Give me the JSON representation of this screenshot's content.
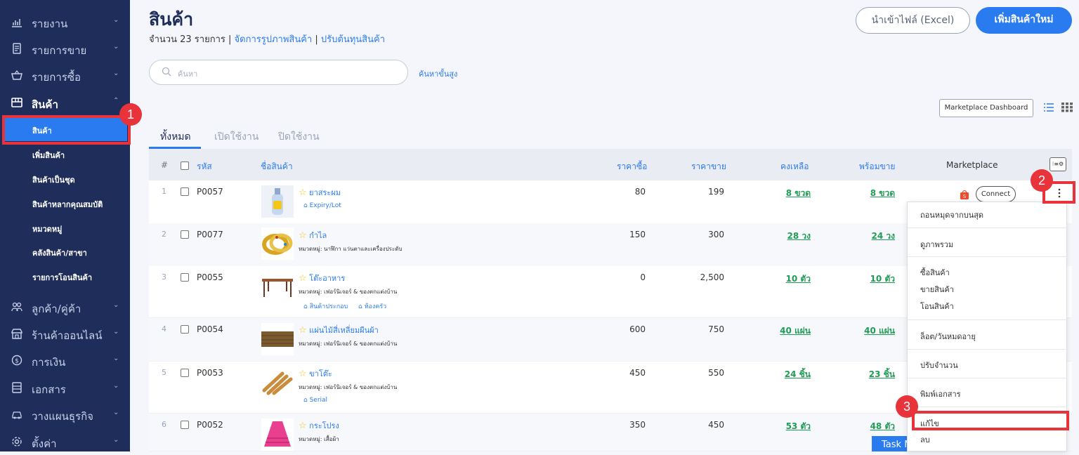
{
  "sidebar": {
    "items": [
      {
        "label": "รายงาน",
        "icon": "bar-chart-icon"
      },
      {
        "label": "รายการขาย",
        "icon": "receipt-icon"
      },
      {
        "label": "รายการซื้อ",
        "icon": "basket-icon"
      },
      {
        "label": "สินค้า",
        "icon": "box-icon"
      },
      {
        "label": "ลูกค้า/คู่ค้า",
        "icon": "users-icon"
      },
      {
        "label": "ร้านค้าออนไลน์",
        "icon": "store-icon"
      },
      {
        "label": "การเงิน",
        "icon": "money-icon"
      },
      {
        "label": "เอกสาร",
        "icon": "document-icon"
      },
      {
        "label": "วางแผนธุรกิจ",
        "icon": "car-icon"
      },
      {
        "label": "ตั้งค่า",
        "icon": "gear-icon"
      }
    ],
    "sub_items": [
      "สินค้า",
      "เพิ่มสินค้า",
      "สินค้าเป็นชุด",
      "สินค้าหลากคุณสมบัติ",
      "หมวดหมู่",
      "คลังสินค้า/สาขา",
      "รายการโอนสินค้า"
    ]
  },
  "annotations": [
    "1",
    "2",
    "3"
  ],
  "header": {
    "title": "สินค้า",
    "count_text": "จำนวน 23 รายการ",
    "link_images": "จัดการรูปภาพสินค้า",
    "link_cost": "ปรับต้นทุนสินค้า",
    "separator": "|",
    "import_label": "นำเข้าไฟล์ (Excel)",
    "add_label": "เพิ่มสินค้าใหม่"
  },
  "search": {
    "placeholder": "ค้นหา",
    "advanced_label": "ค้นหาขั้นสูง"
  },
  "marketplace_dashboard": "Marketplace Dashboard",
  "tabs": [
    "ทั้งหมด",
    "เปิดใช้งาน",
    "ปิดใช้งาน"
  ],
  "table": {
    "headers": {
      "num": "#",
      "code": "รหัส",
      "name": "ชื่อสินค้า",
      "buy": "ราคาซื้อ",
      "sell": "ราคาขาย",
      "remain": "คงเหลือ",
      "ready": "พร้อมขาย",
      "marketplace": "Marketplace"
    },
    "rows": [
      {
        "n": "1",
        "code": "P0057",
        "name": "ยาสระผม",
        "cat": "",
        "tags": [
          "Expiry/Lot"
        ],
        "buy": "80",
        "sell": "199",
        "remain": "8 ขวด",
        "ready": "8 ขวด"
      },
      {
        "n": "2",
        "code": "P0077",
        "name": "กำไล",
        "cat": "หมวดหมู่: นาฬิกา แว่นตาและเครื่องประดับ",
        "tags": [],
        "buy": "150",
        "sell": "300",
        "remain": "28 วง",
        "ready": "24 วง"
      },
      {
        "n": "3",
        "code": "P0055",
        "name": "โต๊ะอาหาร",
        "cat": "หมวดหมู่: เฟอร์นิเจอร์ & ของตกแต่งบ้าน",
        "tags": [
          "สินค้าประกอบ",
          "ห้องครัว"
        ],
        "buy": "0",
        "sell": "2,500",
        "remain": "10 ตัว",
        "ready": "10 ตัว"
      },
      {
        "n": "4",
        "code": "P0054",
        "name": "แผ่นไม้สี่เหลี่ยมผืนผ้า",
        "cat": "หมวดหมู่: เฟอร์นิเจอร์ & ของตกแต่งบ้าน",
        "tags": [],
        "buy": "600",
        "sell": "750",
        "remain": "40 แผ่น",
        "ready": "40 แผ่น"
      },
      {
        "n": "5",
        "code": "P0053",
        "name": "ขาโต๊ะ",
        "cat": "หมวดหมู่: เฟอร์นิเจอร์ & ของตกแต่งบ้าน",
        "tags": [
          "Serial"
        ],
        "buy": "450",
        "sell": "550",
        "remain": "24 ชิ้น",
        "ready": "23 ชิ้น"
      },
      {
        "n": "6",
        "code": "P0052",
        "name": "กระโปรง",
        "cat": "หมวดหมู่: เสื้อผ้า",
        "tags": [],
        "buy": "350",
        "sell": "450",
        "remain": "53 ตัว",
        "ready": "48 ตัว"
      }
    ]
  },
  "connect_label": "Connect",
  "col_config_label": "⁝≡⚙",
  "menu": {
    "items": [
      "ถอนหมุดจากบนสุด",
      "ดูภาพรวม",
      "ซื้อสินค้า",
      "ขายสินค้า",
      "โอนสินค้า",
      "ล็อต/วันหมดอายุ",
      "ปรับจำนวน",
      "พิมพ์เอกสาร",
      "แก้ไข",
      "ลบ"
    ]
  },
  "task_label": "Task M"
}
